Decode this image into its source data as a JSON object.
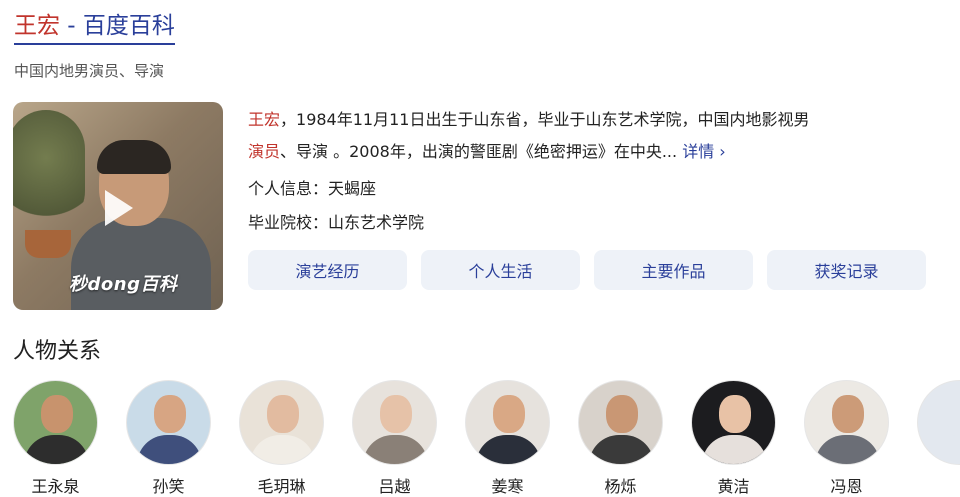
{
  "header": {
    "title_name": "王宏",
    "title_sep": " - ",
    "title_site": "百度百科",
    "subtitle": "中国内地男演员、导演"
  },
  "video": {
    "watermark": "秒dong百科",
    "play_icon": "play-icon"
  },
  "summary": {
    "name": "王宏",
    "text1": "，1984年11月11日出生于山东省，毕业于山东艺术学院，中国内地影视男",
    "role": "演员",
    "text2": "、导演 。2008年，出演的警匪剧《绝密押运》在中央...",
    "more_label": "详情",
    "more_icon": "chevron-right-icon"
  },
  "info": {
    "zodiac_label": "个人信息：",
    "zodiac_value": "天蝎座",
    "school_label": "毕业院校：",
    "school_value": "山东艺术学院"
  },
  "tabs": [
    {
      "label": "演艺经历"
    },
    {
      "label": "个人生活"
    },
    {
      "label": "主要作品"
    },
    {
      "label": "获奖记录"
    }
  ],
  "relations": {
    "title": "人物关系",
    "people": [
      {
        "name": "王永泉",
        "bg": "#7fa36a",
        "face": "#c8936d",
        "body": "#2d2d2d"
      },
      {
        "name": "孙笑",
        "bg": "#c9dbe8",
        "face": "#d7a583",
        "body": "#3f4f7c"
      },
      {
        "name": "毛玥琳",
        "bg": "#e9e2d8",
        "face": "#e2bba0",
        "body": "#f1ede6"
      },
      {
        "name": "吕越",
        "bg": "#e7e2dc",
        "face": "#e6c2a8",
        "body": "#8a8077"
      },
      {
        "name": "姜寒",
        "bg": "#e6e2dd",
        "face": "#d9a885",
        "body": "#2a2f3a"
      },
      {
        "name": "杨烁",
        "bg": "#d8d2cb",
        "face": "#c99774",
        "body": "#3a3a3a"
      },
      {
        "name": "黄洁",
        "bg": "#1c1c1f",
        "face": "#e8c2a6",
        "body": "#e6e0dc"
      },
      {
        "name": "冯恩",
        "bg": "#ece9e4",
        "face": "#cc9b78",
        "body": "#6b6e76"
      },
      {
        "name": "",
        "bg": "#e3e8ef",
        "face": "#e3e8ef",
        "body": "#e3e8ef"
      }
    ]
  }
}
